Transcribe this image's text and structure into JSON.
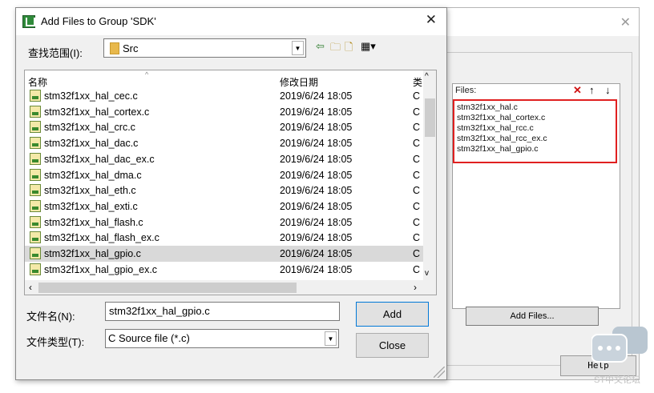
{
  "dialog": {
    "title": "Add Files to Group 'SDK'",
    "close_symbol": "✕"
  },
  "lookin": {
    "label": "查找范围(I):",
    "value": "Src",
    "toolbar_icons": [
      "back-arrow-icon",
      "up-folder-icon",
      "new-folder-icon",
      "view-menu-icon"
    ]
  },
  "file_list": {
    "columns": [
      "名称",
      "修改日期",
      "类"
    ],
    "rows": [
      {
        "name": "stm32f1xx_hal_cec.c",
        "date": "2019/6/24 18:05",
        "type": "C"
      },
      {
        "name": "stm32f1xx_hal_cortex.c",
        "date": "2019/6/24 18:05",
        "type": "C"
      },
      {
        "name": "stm32f1xx_hal_crc.c",
        "date": "2019/6/24 18:05",
        "type": "C"
      },
      {
        "name": "stm32f1xx_hal_dac.c",
        "date": "2019/6/24 18:05",
        "type": "C"
      },
      {
        "name": "stm32f1xx_hal_dac_ex.c",
        "date": "2019/6/24 18:05",
        "type": "C"
      },
      {
        "name": "stm32f1xx_hal_dma.c",
        "date": "2019/6/24 18:05",
        "type": "C"
      },
      {
        "name": "stm32f1xx_hal_eth.c",
        "date": "2019/6/24 18:05",
        "type": "C"
      },
      {
        "name": "stm32f1xx_hal_exti.c",
        "date": "2019/6/24 18:05",
        "type": "C"
      },
      {
        "name": "stm32f1xx_hal_flash.c",
        "date": "2019/6/24 18:05",
        "type": "C"
      },
      {
        "name": "stm32f1xx_hal_flash_ex.c",
        "date": "2019/6/24 18:05",
        "type": "C"
      },
      {
        "name": "stm32f1xx_hal_gpio.c",
        "date": "2019/6/24 18:05",
        "type": "C",
        "selected": true
      },
      {
        "name": "stm32f1xx_hal_gpio_ex.c",
        "date": "2019/6/24 18:05",
        "type": "C"
      }
    ]
  },
  "filename": {
    "label": "文件名(N):",
    "value": "stm32f1xx_hal_gpio.c"
  },
  "filetype": {
    "label": "文件类型(T):",
    "value": "C Source file (*.c)"
  },
  "buttons": {
    "add": "Add",
    "close": "Close"
  },
  "bg_dialog": {
    "close_symbol": "✕",
    "files_label": "Files:",
    "files": [
      "stm32f1xx_hal.c",
      "stm32f1xx_hal_cortex.c",
      "stm32f1xx_hal_rcc.c",
      "stm32f1xx_hal_rcc_ex.c",
      "stm32f1xx_hal_gpio.c"
    ],
    "add_files_label": "Add Files...",
    "help_label": "Help",
    "highlight_color": "#e02020"
  },
  "watermark": {
    "text": "ST中文论坛"
  }
}
